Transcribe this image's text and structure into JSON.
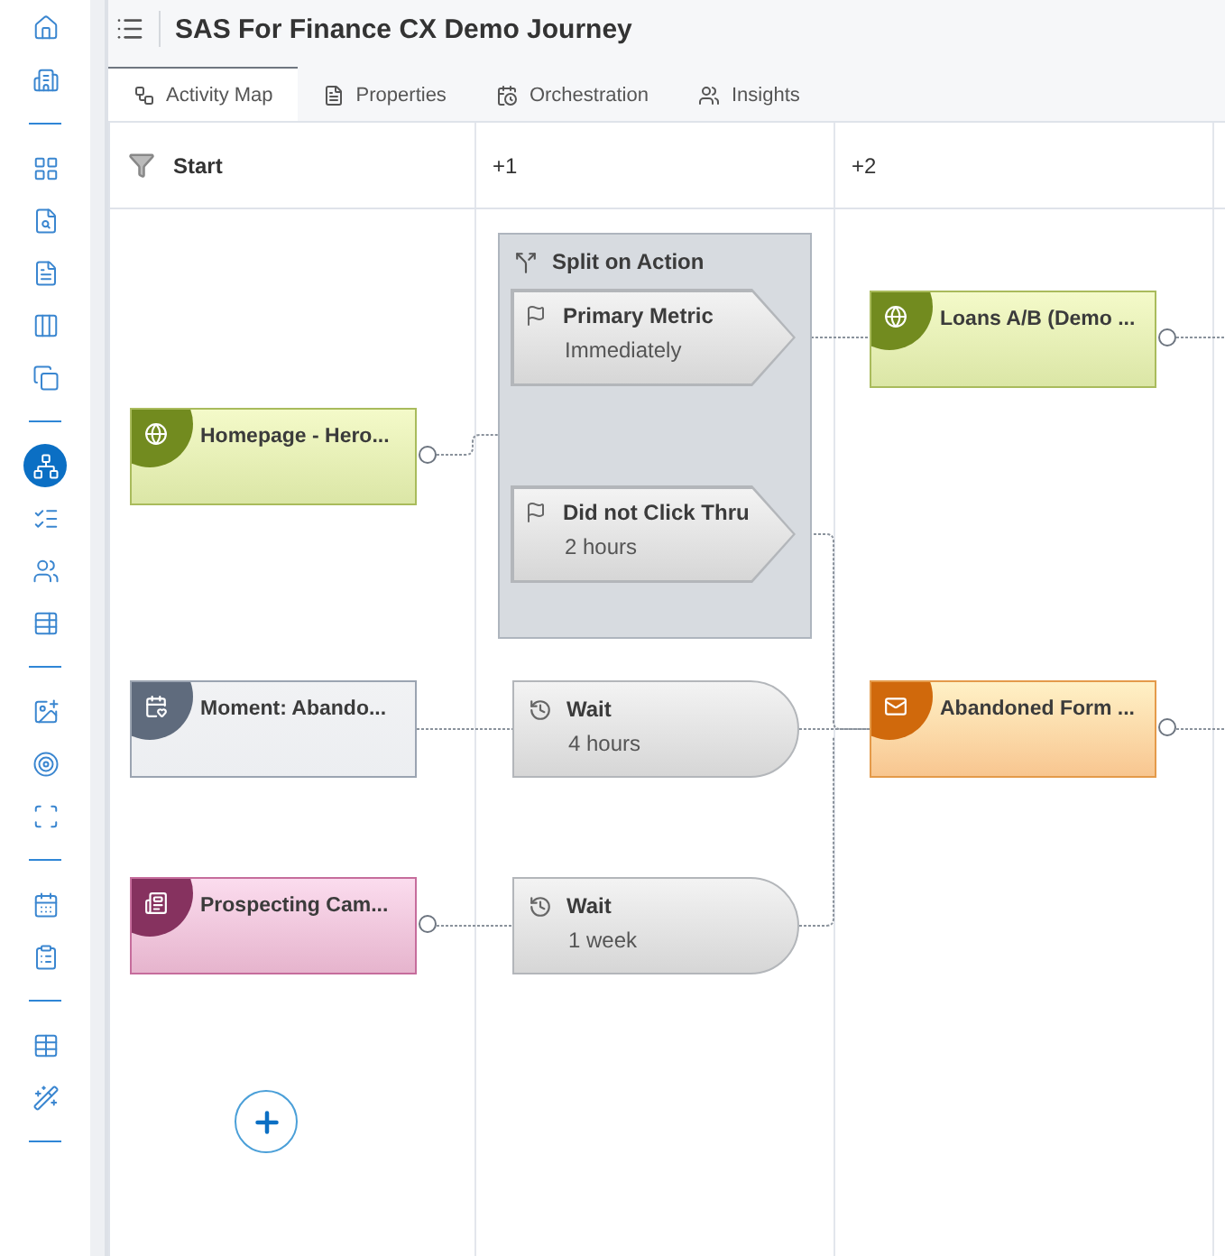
{
  "rail": {
    "groups": [
      [
        {
          "selected": false
        },
        {
          "selected": false
        }
      ],
      [
        {
          "selected": false
        },
        {
          "selected": false
        },
        {
          "selected": false
        },
        {
          "selected": false
        },
        {
          "selected": false
        }
      ],
      [
        {
          "selected": true
        },
        {
          "selected": false
        },
        {
          "selected": false
        },
        {
          "selected": false
        }
      ],
      [
        {
          "selected": false
        },
        {
          "selected": false
        },
        {
          "selected": false
        }
      ],
      [
        {
          "selected": false
        },
        {
          "selected": false
        }
      ],
      [
        {
          "selected": false
        },
        {
          "selected": false
        }
      ]
    ]
  },
  "header": {
    "title": "SAS For Finance CX Demo Journey"
  },
  "tabs": [
    {
      "label": "Activity Map",
      "selected": true
    },
    {
      "label": "Properties",
      "selected": false
    },
    {
      "label": "Orchestration",
      "selected": false
    },
    {
      "label": "Insights",
      "selected": false
    }
  ],
  "columns": [
    {
      "label": "Start",
      "nodes": [
        {
          "kind": "web",
          "title": "Homepage - Hero...",
          "port": true
        },
        {
          "kind": "moment",
          "title": "Moment: Abando...",
          "port": false
        },
        {
          "kind": "direct",
          "title": "Prospecting Cam...",
          "port": true
        }
      ]
    },
    {
      "label": "+1",
      "nodes": [
        {
          "kind": "split",
          "title": "Split on Action",
          "branches": [
            {
              "title": "Primary Metric",
              "subtitle": "Immediately"
            },
            {
              "title": "Did not Click Thru",
              "subtitle": "2 hours"
            }
          ]
        },
        {
          "kind": "wait",
          "title": "Wait",
          "subtitle": "4 hours"
        },
        {
          "kind": "wait",
          "title": "Wait",
          "subtitle": "1 week"
        }
      ]
    },
    {
      "label": "+2",
      "nodes": [
        {
          "kind": "web",
          "title": "Loans A/B (Demo ...",
          "port": true
        },
        {
          "kind": "email",
          "title": "Abandoned Form ...",
          "port": true
        }
      ]
    }
  ]
}
